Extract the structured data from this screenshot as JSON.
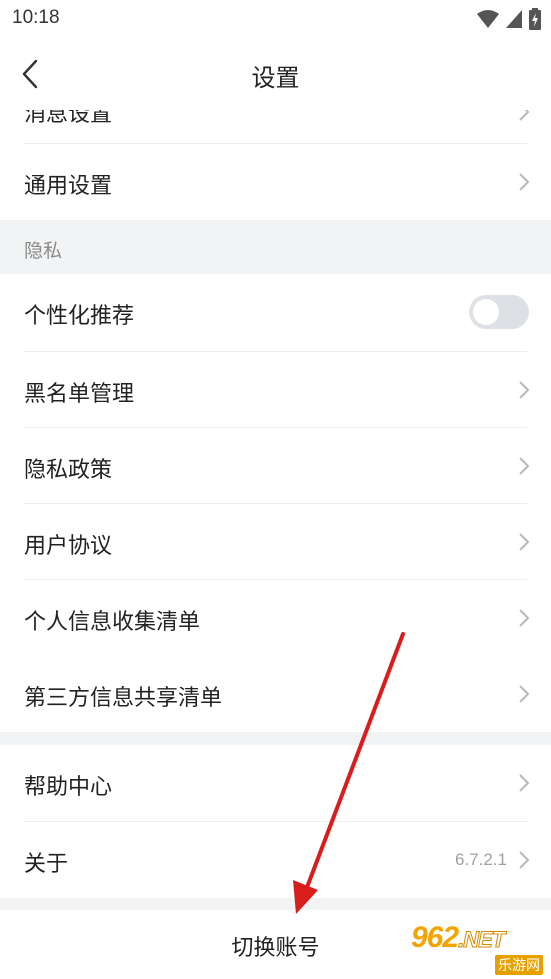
{
  "status_bar": {
    "time": "10:18"
  },
  "nav": {
    "title": "设置"
  },
  "rows": {
    "message_settings": "消息设置",
    "general_settings": "通用设置",
    "privacy_section": "隐私",
    "personalized_recommend": "个性化推荐",
    "personalized_recommend_enabled": false,
    "blacklist": "黑名单管理",
    "privacy_policy": "隐私政策",
    "user_agreement": "用户协议",
    "personal_info_list": "个人信息收集清单",
    "third_party_list": "第三方信息共享清单",
    "help_center": "帮助中心",
    "about": "关于",
    "version": "6.7.2.1"
  },
  "bottom": {
    "switch_account": "切换账号"
  },
  "watermark": {
    "main": "962",
    "suffix": ".NET",
    "sub": "乐游网"
  },
  "colors": {
    "arrow": "#d91c1c",
    "watermark": "#f4a400"
  }
}
